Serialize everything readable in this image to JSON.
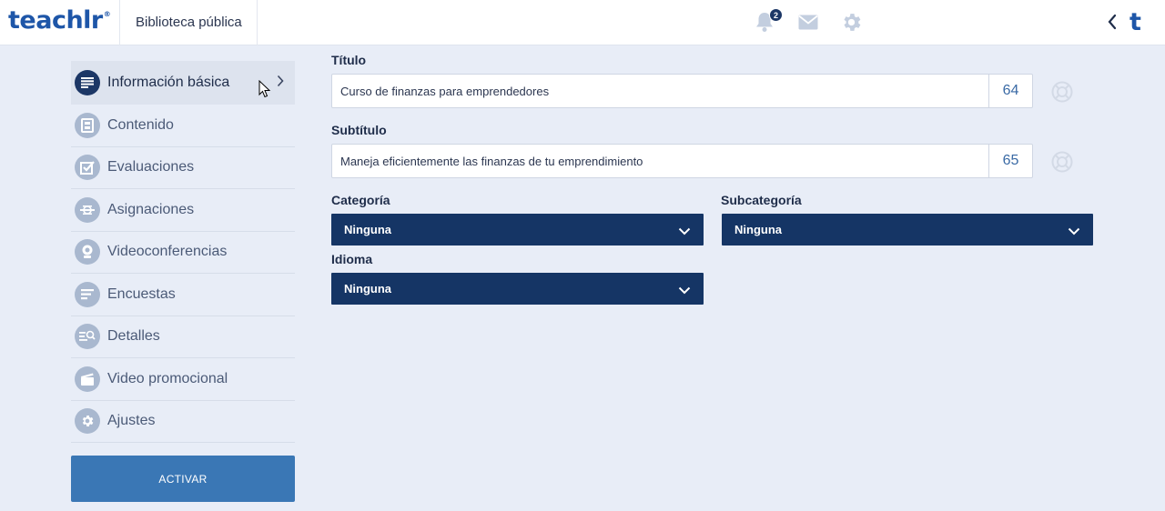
{
  "header": {
    "logo_text": "teachlr",
    "logo_mark": "®",
    "library_label": "Biblioteca pública",
    "notification_count": "2",
    "icons": [
      "bell-icon",
      "mail-icon",
      "gear-icon",
      "chevron-left-icon"
    ],
    "brand_short": "t"
  },
  "sidebar": {
    "items": [
      {
        "label": "Información básica",
        "icon": "list-icon",
        "active": true
      },
      {
        "label": "Contenido",
        "icon": "film-icon"
      },
      {
        "label": "Evaluaciones",
        "icon": "checkbox-icon"
      },
      {
        "label": "Asignaciones",
        "icon": "assignment-icon"
      },
      {
        "label": "Videoconferencias",
        "icon": "webcam-icon"
      },
      {
        "label": "Encuestas",
        "icon": "survey-icon"
      },
      {
        "label": "Detalles",
        "icon": "details-icon"
      },
      {
        "label": "Video promocional",
        "icon": "clapper-icon"
      },
      {
        "label": "Ajustes",
        "icon": "gear-icon"
      }
    ],
    "activate_label": "ACTIVAR"
  },
  "form": {
    "title_label": "Título",
    "title_value": "Curso de finanzas para emprendedores",
    "title_counter": "64",
    "subtitle_label": "Subtítulo",
    "subtitle_value": "Maneja eficientemente las finanzas de tu emprendimiento",
    "subtitle_counter": "65",
    "category_label": "Categoría",
    "category_value": "Ninguna",
    "subcategory_label": "Subcategoría",
    "subcategory_value": "Ninguna",
    "language_label": "Idioma",
    "language_value": "Ninguna"
  },
  "colors": {
    "brand": "#1e56a8",
    "navy": "#153565",
    "background": "#e8edf7",
    "button": "#3a77b5"
  }
}
